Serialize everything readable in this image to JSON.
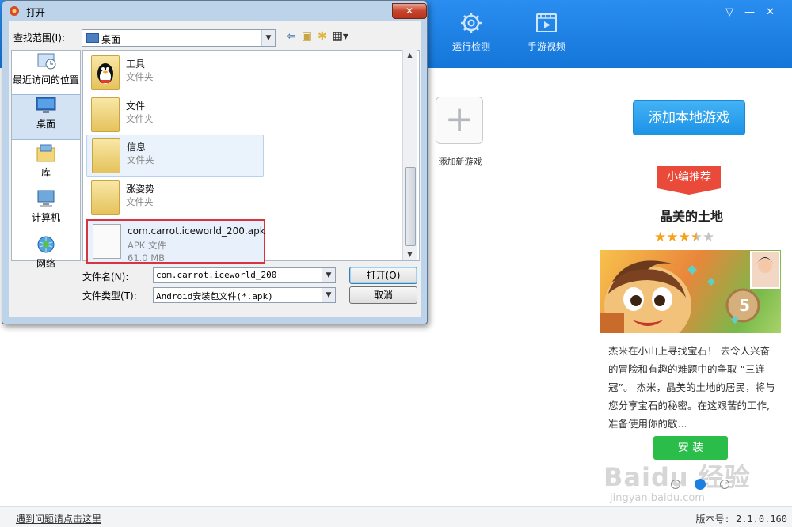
{
  "app": {
    "top_tabs": [
      {
        "label": "运行检测",
        "icon": "gear-icon"
      },
      {
        "label": "手游视频",
        "icon": "video-icon"
      }
    ],
    "window_controls": [
      "▽",
      "—",
      "✕"
    ],
    "add_game_tile": {
      "icon": "plus-icon",
      "label": "添加新游戏"
    },
    "right_panel": {
      "add_local_button": "添加本地游戏",
      "recommend_tag": "小编推荐",
      "game_title": "晶美的土地",
      "rating": 3.5,
      "rating_max": 5,
      "description": "杰米在小山上寻找宝石！ 去令人兴奋的冒险和有趣的难题中的争取 “三连冠”。 杰米，晶美的土地的居民，将与您分享宝石的秘密。在这艰苦的工作,准备使用你的敏...",
      "install_button": "安 装",
      "carousel_pages": 3,
      "carousel_active": 2,
      "watermark": "Baidu 经验",
      "watermark_url": "jingyan.baidu.com"
    },
    "status_bar": {
      "help_link": "遇到问题请点击这里",
      "version": "版本号: 2.1.0.160"
    }
  },
  "dialog": {
    "title": "打开",
    "close_symbol": "✕",
    "look_in_label": "查找范围(I):",
    "look_in_value": "桌面",
    "places": [
      {
        "label": "最近访问的位置",
        "icon": "recent-places-icon",
        "active": false
      },
      {
        "label": "桌面",
        "icon": "desktop-icon",
        "active": true
      },
      {
        "label": "库",
        "icon": "library-icon",
        "active": false
      },
      {
        "label": "计算机",
        "icon": "computer-icon",
        "active": false
      },
      {
        "label": "网络",
        "icon": "network-icon",
        "active": false
      }
    ],
    "files": [
      {
        "name": "工具",
        "type": "文件夹",
        "size": "",
        "icon": "qq-folder-icon",
        "state": "normal"
      },
      {
        "name": "文件",
        "type": "文件夹",
        "size": "",
        "icon": "folder-icon",
        "state": "normal"
      },
      {
        "name": "信息",
        "type": "文件夹",
        "size": "",
        "icon": "folder-icon",
        "state": "hover"
      },
      {
        "name": "涨姿势",
        "type": "文件夹",
        "size": "",
        "icon": "folder-icon",
        "state": "normal"
      },
      {
        "name": "com.carrot.iceworld_200.apk",
        "type": "APK 文件",
        "size": "61.0 MB",
        "icon": "apk-file-icon",
        "state": "selected"
      }
    ],
    "file_name_label": "文件名(N):",
    "file_name_value": "com.carrot.iceworld_200",
    "file_type_label": "文件类型(T):",
    "file_type_value": "Android安装包文件(*.apk)",
    "open_button": "打开(O)",
    "cancel_button": "取消"
  },
  "colors": {
    "app_header": "#1f84e6",
    "selection_border": "#d8343f",
    "install_green": "#2bbd4a",
    "recommend_red": "#ea4a39"
  }
}
